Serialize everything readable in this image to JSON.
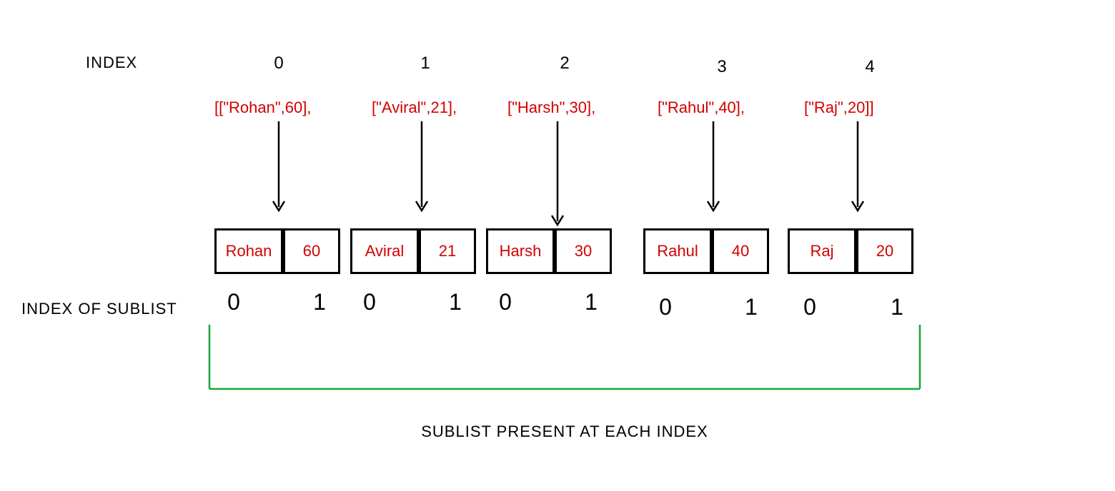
{
  "labels": {
    "index": "INDEX",
    "sublist_index": "INDEX OF SUBLIST",
    "caption": "SUBLIST PRESENT AT EACH INDEX"
  },
  "columns": [
    {
      "index": "0",
      "literal": "[[\"Rohan\",60],",
      "name": "Rohan",
      "value": "60",
      "sub0": "0",
      "sub1": "1"
    },
    {
      "index": "1",
      "literal": "[\"Aviral\",21],",
      "name": "Aviral",
      "value": "21",
      "sub0": "0",
      "sub1": "1"
    },
    {
      "index": "2",
      "literal": "[\"Harsh\",30],",
      "name": "Harsh",
      "value": "30",
      "sub0": "0",
      "sub1": "1"
    },
    {
      "index": "3",
      "literal": "[\"Rahul\",40],",
      "name": "Rahul",
      "value": "40",
      "sub0": "0",
      "sub1": "1"
    },
    {
      "index": "4",
      "literal": "[\"Raj\",20]]",
      "name": "Raj",
      "value": "20",
      "sub0": "0",
      "sub1": "1"
    }
  ],
  "chart_data": {
    "type": "table",
    "title": "SUBLIST PRESENT AT EACH INDEX",
    "outer_indices": [
      0,
      1,
      2,
      3,
      4
    ],
    "sublist_indices": [
      0,
      1
    ],
    "rows": [
      {
        "name": "Rohan",
        "value": 60
      },
      {
        "name": "Aviral",
        "value": 21
      },
      {
        "name": "Harsh",
        "value": 30
      },
      {
        "name": "Rahul",
        "value": 40
      },
      {
        "name": "Raj",
        "value": 20
      }
    ]
  }
}
